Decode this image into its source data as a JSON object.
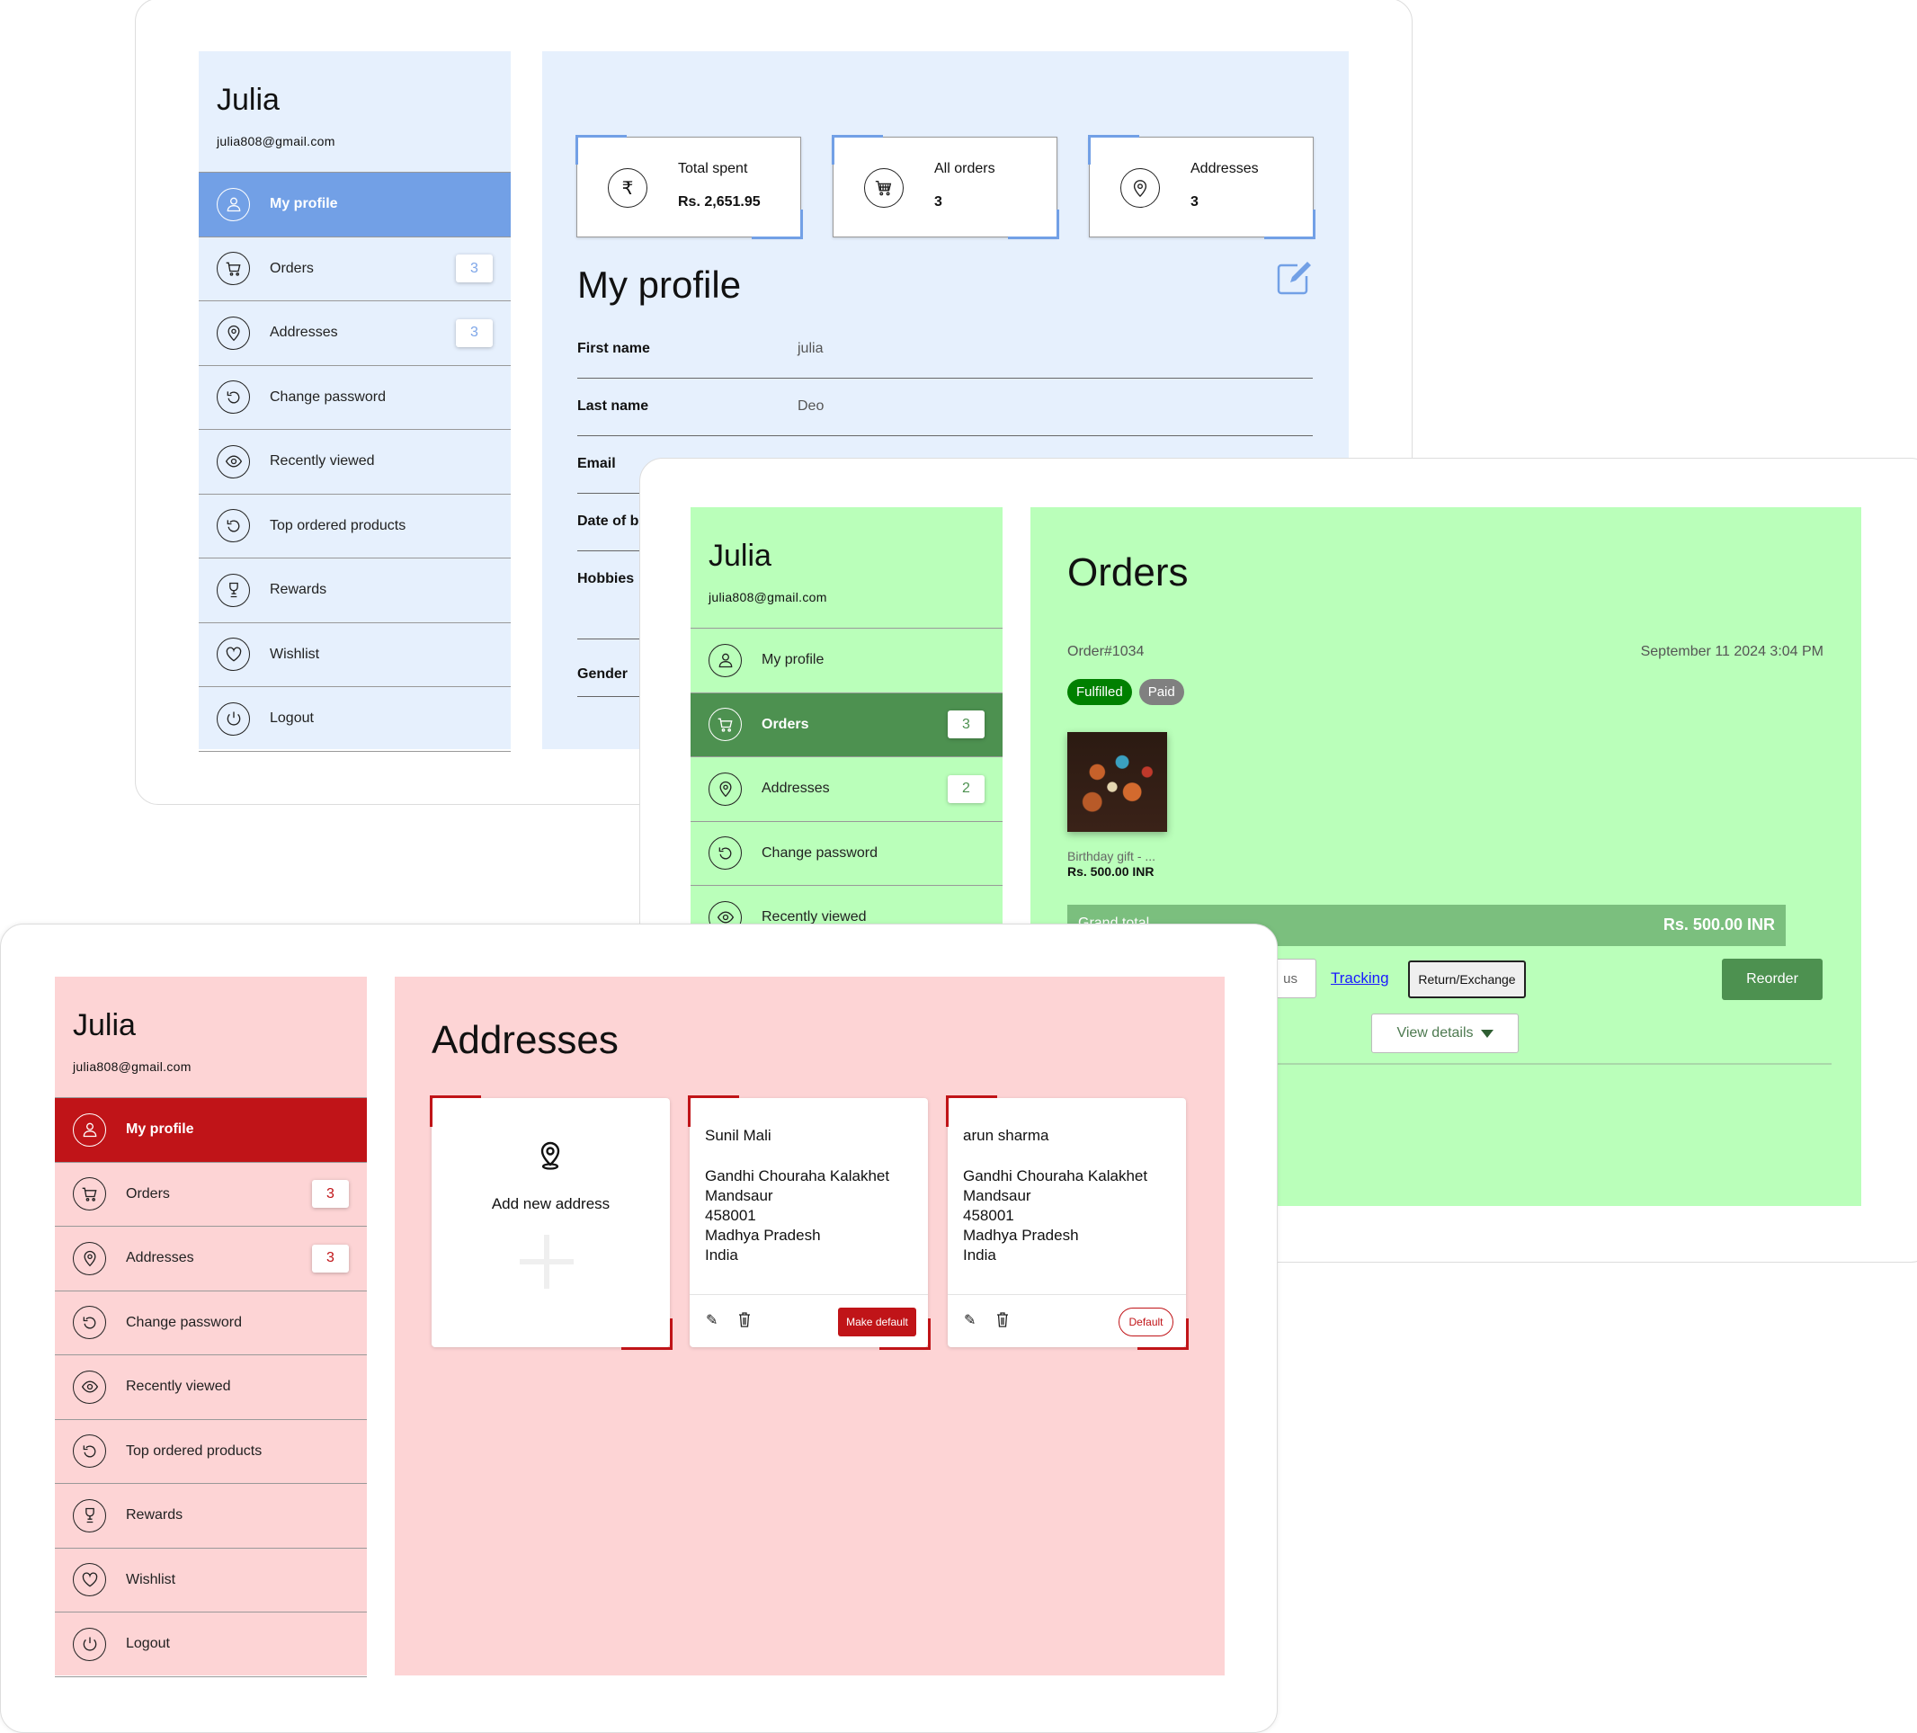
{
  "user": {
    "name": "Julia",
    "email": "julia808@gmail.com"
  },
  "sidebars": {
    "profile": [
      {
        "label": "My profile",
        "icon": "user-icon",
        "active": true
      },
      {
        "label": "Orders",
        "icon": "cart-icon",
        "badge": "3"
      },
      {
        "label": "Addresses",
        "icon": "location-pin-icon",
        "badge": "3"
      },
      {
        "label": "Change password",
        "icon": "refresh-icon"
      },
      {
        "label": "Recently viewed",
        "icon": "eye-icon"
      },
      {
        "label": "Top ordered products",
        "icon": "refresh-icon"
      },
      {
        "label": "Rewards",
        "icon": "trophy-icon"
      },
      {
        "label": "Wishlist",
        "icon": "heart-icon"
      },
      {
        "label": "Logout",
        "icon": "power-icon"
      }
    ],
    "orders": [
      {
        "label": "My profile",
        "icon": "user-icon"
      },
      {
        "label": "Orders",
        "icon": "cart-icon",
        "badge": "3",
        "active": true
      },
      {
        "label": "Addresses",
        "icon": "location-pin-icon",
        "badge": "2"
      },
      {
        "label": "Change password",
        "icon": "refresh-icon"
      },
      {
        "label": "Recently viewed",
        "icon": "eye-icon"
      }
    ],
    "addresses": [
      {
        "label": "My profile",
        "icon": "user-icon",
        "active": true
      },
      {
        "label": "Orders",
        "icon": "cart-icon",
        "badge": "3"
      },
      {
        "label": "Addresses",
        "icon": "location-pin-icon",
        "badge": "3"
      },
      {
        "label": "Change password",
        "icon": "refresh-icon"
      },
      {
        "label": "Recently viewed",
        "icon": "eye-icon"
      },
      {
        "label": "Top ordered products",
        "icon": "refresh-icon"
      },
      {
        "label": "Rewards",
        "icon": "trophy-icon"
      },
      {
        "label": "Wishlist",
        "icon": "heart-icon"
      },
      {
        "label": "Logout",
        "icon": "power-icon"
      }
    ]
  },
  "stats": [
    {
      "title": "Total spent",
      "value": "Rs. 2,651.95",
      "icon": "rupee-icon"
    },
    {
      "title": "All orders",
      "value": "3",
      "icon": "cart-icon"
    },
    {
      "title": "Addresses",
      "value": "3",
      "icon": "location-pin-icon"
    }
  ],
  "profile": {
    "title": "My profile",
    "fields": [
      {
        "label": "First name",
        "value": "julia"
      },
      {
        "label": "Last name",
        "value": "Deo"
      },
      {
        "label": "Email",
        "value": ""
      },
      {
        "label": "Date of birth",
        "value": ""
      },
      {
        "label": "Hobbies",
        "value": ""
      },
      {
        "label": "Gender",
        "value": ""
      }
    ]
  },
  "orders": {
    "title": "Orders",
    "order_number": "Order#1034",
    "date": "September 11 2024 3:04 PM",
    "fulfillment": "Fulfilled",
    "payment": "Paid",
    "item_name": "Birthday gift - ...",
    "item_price": "Rs. 500.00 INR",
    "grand_total_label": "Grand total",
    "grand_total": "Rs. 500.00 INR",
    "status_button": "us",
    "tracking": "Tracking",
    "return_exchange": "Return/Exchange",
    "reorder": "Reorder",
    "view_details": "View details",
    "colors": {
      "fulfilled": "#008000",
      "paid": "#808080",
      "reorder": "#4d9150"
    }
  },
  "addresses": {
    "title": "Addresses",
    "add_new": "Add new address",
    "make_default": "Make default",
    "default": "Default",
    "cards": [
      {
        "name": "Sunil Mali",
        "lines": [
          "Gandhi Chouraha Kalakhet",
          "Mandsaur",
          "458001",
          "Madhya Pradesh",
          "India"
        ],
        "is_default": false
      },
      {
        "name": "arun sharma",
        "lines": [
          "Gandhi Chouraha Kalakhet",
          "Mandsaur",
          "458001",
          "Madhya Pradesh",
          "India"
        ],
        "is_default": true
      }
    ]
  }
}
